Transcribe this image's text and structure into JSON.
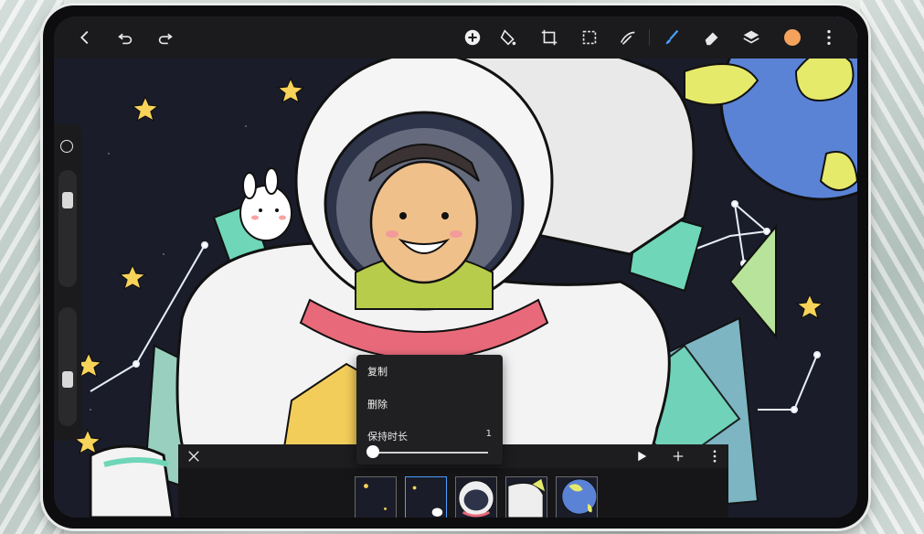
{
  "toolbar": {
    "left_icons": [
      "back-icon",
      "undo-icon",
      "redo-icon"
    ],
    "right_icons": [
      "add-icon",
      "adjust-icon",
      "transform-icon",
      "select-icon",
      "lasso-icon",
      "brush-icon",
      "eraser-icon",
      "layers-icon",
      "color-swatch",
      "more-icon"
    ],
    "current_color": "#F5A25D"
  },
  "sidebar": {
    "top_icon": "circle-icon",
    "brush_size_level": 0.4,
    "opacity_level": 0.15
  },
  "context_menu": {
    "items": [
      "复制",
      "删除"
    ],
    "hold_label": "保持时长",
    "hold_value": "1",
    "hold_slider_level": 0.0
  },
  "animation_bar": {
    "icons": [
      "close-icon",
      "play-icon",
      "add-frame-icon",
      "more-icon"
    ],
    "frames": [
      {
        "thumb": "stars-dark"
      },
      {
        "thumb": "bunny-stars",
        "selected": true
      },
      {
        "thumb": "astronaut-helmet"
      },
      {
        "thumb": "astronaut-arm"
      },
      {
        "thumb": "planet-blue"
      }
    ]
  },
  "colors": {
    "background_dark": "#1A1D29",
    "toolbar": "#1B1B1D",
    "accent_blue": "#4AA0FF",
    "star_yellow": "#F7D359",
    "teal": "#6FD6B8",
    "planet_blue": "#5A83D6",
    "planet_yellow": "#E6EA6A",
    "collar_pink": "#E86A7A"
  }
}
